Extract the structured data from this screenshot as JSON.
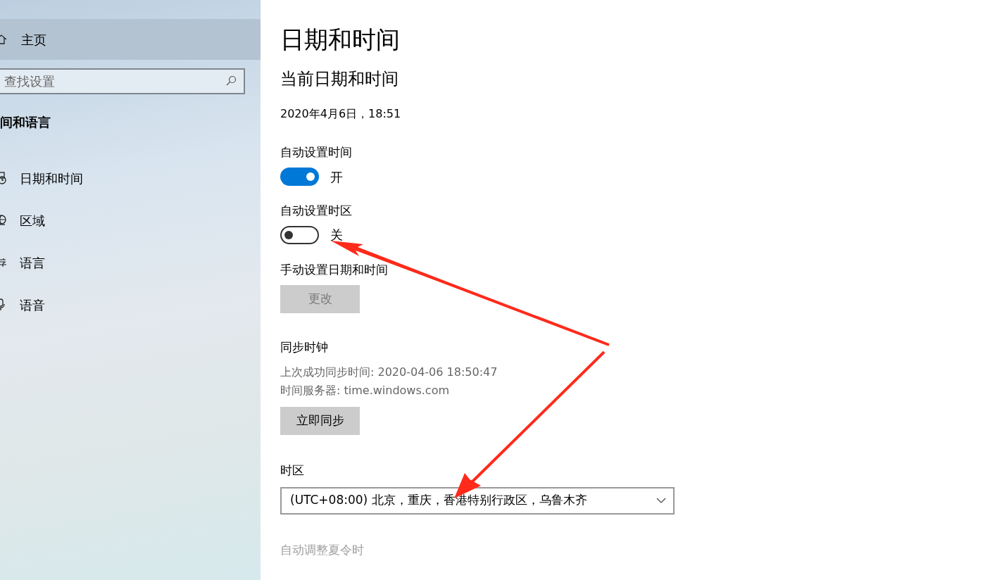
{
  "sidebar": {
    "home": {
      "label": "主页",
      "selected": true
    },
    "search": {
      "placeholder": "查找设置"
    },
    "section_title": "间和语言",
    "items": [
      {
        "label": "日期和时间",
        "kind": "clock"
      },
      {
        "label": "区域",
        "kind": "globe"
      },
      {
        "label": "语言",
        "kind": "glyph"
      },
      {
        "label": "语音",
        "kind": "mic"
      }
    ]
  },
  "page": {
    "title": "日期和时间",
    "subtitle": "当前日期和时间",
    "current": "2020年4月6日，18:51",
    "toggles": [
      {
        "label": "自动设置时间",
        "on": true,
        "state_text": "开"
      },
      {
        "label": "自动设置时区",
        "on": false,
        "state_text": "关"
      }
    ],
    "manual": {
      "label": "手动设置日期和时间",
      "button": "更改",
      "disabled": true
    },
    "sync": {
      "title": "同步时钟",
      "lines": [
        "上次成功同步时间: 2020-04-06 18:50:47",
        "时间服务器: time.windows.com"
      ],
      "button": "立即同步"
    },
    "timezone": {
      "label": "时区",
      "value": "(UTC+08:00) 北京，重庆，香港特别行政区，乌鲁木齐"
    },
    "dst": {
      "label": "自动调整夏令时",
      "disabled": true
    }
  }
}
